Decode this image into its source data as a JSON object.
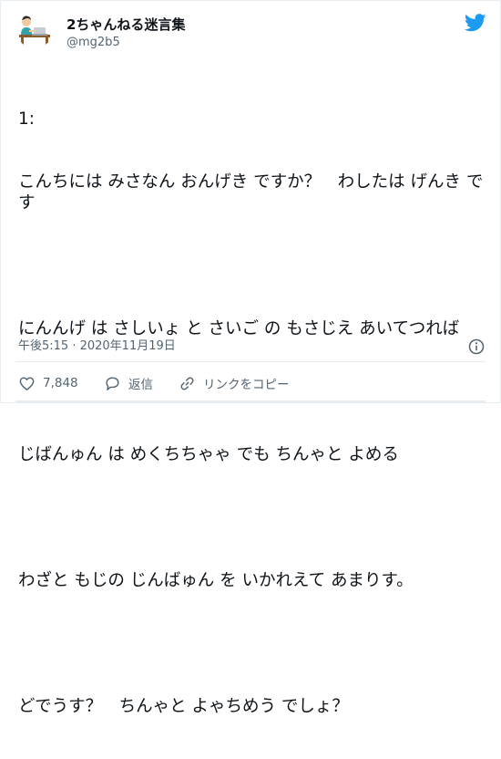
{
  "user": {
    "display_name": "2ちゃんねる迷言集",
    "handle": "@mg2b5"
  },
  "tweet": {
    "lines": [
      "1:",
      "こんちには みさなん おんげき ですか？　わしたは げんき です",
      "",
      "にんんげ は さしいょ と さいご の もさじえ あいてつれば",
      "",
      "じばんゅん は めくちちゃゃ でも ちんゃと よめる",
      "",
      "わざと もじの じんばゅん を いかれえて あまりす。",
      "",
      "どでうす？　ちんゃと よゃちめう でしょ？"
    ],
    "timestamp": "午後5:15 · 2020年11月19日"
  },
  "actions": {
    "likes": "7,848",
    "reply_label": "返信",
    "copy_link_label": "リンクをコピー"
  },
  "colors": {
    "twitter_blue": "#1d9bf0",
    "text": "#0f1419",
    "secondary": "#536471",
    "border": "#e6ecf0"
  },
  "icons": [
    "twitter-bird-icon",
    "info-icon",
    "heart-icon",
    "reply-icon",
    "link-icon"
  ]
}
